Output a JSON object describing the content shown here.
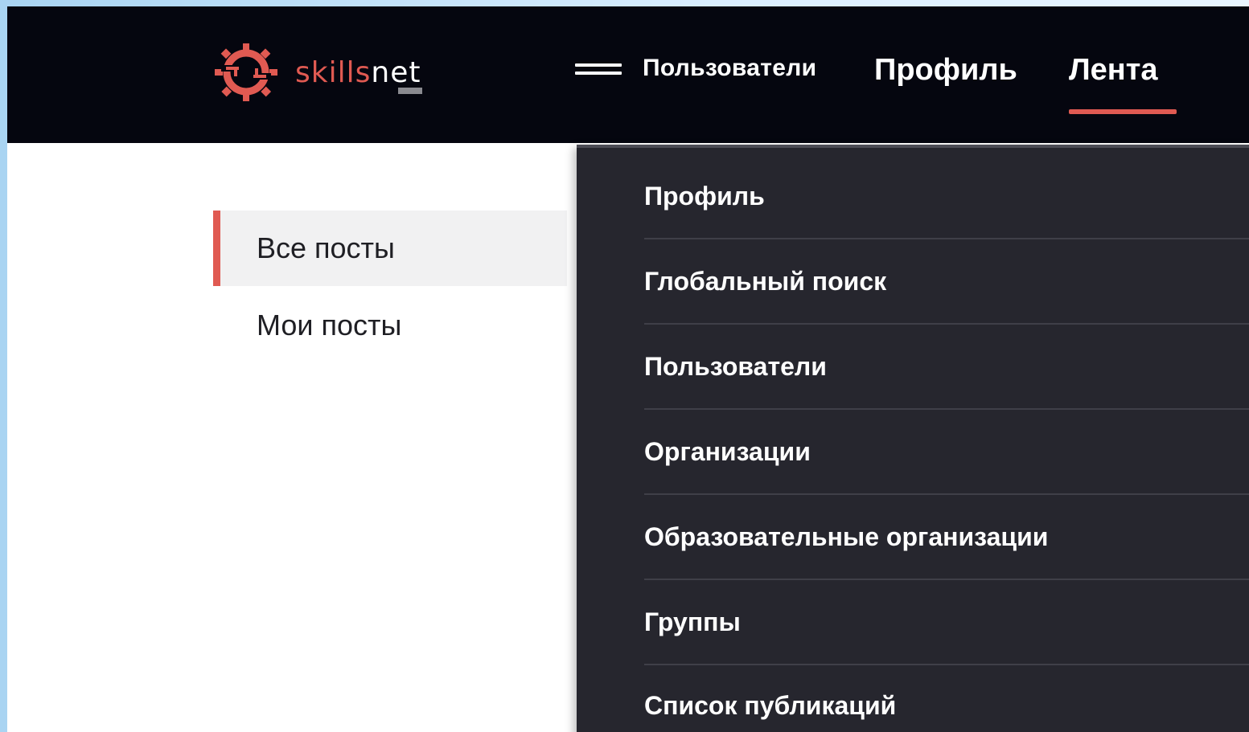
{
  "brand": {
    "logo_primary": "skills",
    "logo_secondary": "net",
    "accent_color": "#e05a52",
    "icon": "gear-logo-icon"
  },
  "header": {
    "menu_toggle_label": "Пользователи",
    "menu_icon": "hamburger-icon",
    "links": {
      "profile": "Профиль",
      "feed": "Лента"
    },
    "active_link": "Лента"
  },
  "sidebar": {
    "items": [
      {
        "label": "Все посты",
        "active": true
      },
      {
        "label": "Мои посты",
        "active": false
      }
    ]
  },
  "dropdown": {
    "items": [
      {
        "label": "Профиль"
      },
      {
        "label": "Глобальный поиск"
      },
      {
        "label": "Пользователи"
      },
      {
        "label": "Организации"
      },
      {
        "label": "Образовательные организации"
      },
      {
        "label": "Группы"
      },
      {
        "label": "Список публикаций"
      }
    ]
  }
}
